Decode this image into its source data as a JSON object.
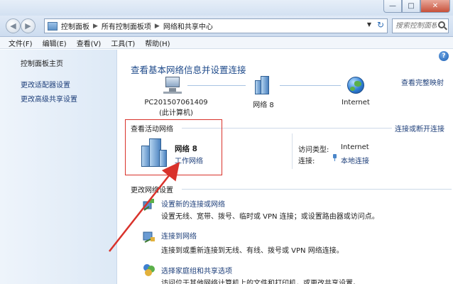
{
  "window": {
    "minimize_glyph": "—",
    "maximize_glyph": "□",
    "close_glyph": "✕"
  },
  "nav": {
    "back_glyph": "◀",
    "forward_glyph": "▶",
    "breadcrumb": [
      "控制面板",
      "所有控制面板项",
      "网络和共享中心"
    ],
    "breadcrumb_separator": "▶",
    "dropdown_glyph": "▼",
    "refresh_glyph": "↻",
    "search_placeholder": "搜索控制面板"
  },
  "menu": [
    "文件(F)",
    "编辑(E)",
    "查看(V)",
    "工具(T)",
    "帮助(H)"
  ],
  "left_pane": {
    "home": "控制面板主页",
    "links": [
      "更改适配器设置",
      "更改高级共享设置"
    ]
  },
  "main": {
    "help_glyph": "?",
    "title": "查看基本网络信息并设置连接",
    "full_map_link": "查看完整映射",
    "map_nodes": [
      {
        "name": "PC201507061409",
        "sub": "(此计算机)"
      },
      {
        "name": "网络  8",
        "sub": ""
      },
      {
        "name": "Internet",
        "sub": ""
      }
    ],
    "active_networks": {
      "heading": "查看活动网络",
      "connect_link": "连接或断开连接",
      "network_name": "网络  8",
      "network_type": "工作网络",
      "access_type_key": "访问类型:",
      "access_type_value": "Internet",
      "connection_key": "连接:",
      "connection_value": "本地连接"
    },
    "change_settings": {
      "heading": "更改网络设置",
      "tasks": [
        {
          "title": "设置新的连接或网络",
          "desc": "设置无线、宽带、拨号、临时或 VPN 连接；或设置路由器或访问点。"
        },
        {
          "title": "连接到网络",
          "desc": "连接到或重新连接到无线、有线、拨号或 VPN 网络连接。"
        },
        {
          "title": "选择家庭组和共享选项",
          "desc": "访问位于其他网络计算机上的文件和打印机，或更改共享设置。"
        }
      ]
    }
  },
  "colors": {
    "link": "#1e3f7a",
    "title": "#1e4a8a",
    "annotation_red": "#d9322b"
  }
}
